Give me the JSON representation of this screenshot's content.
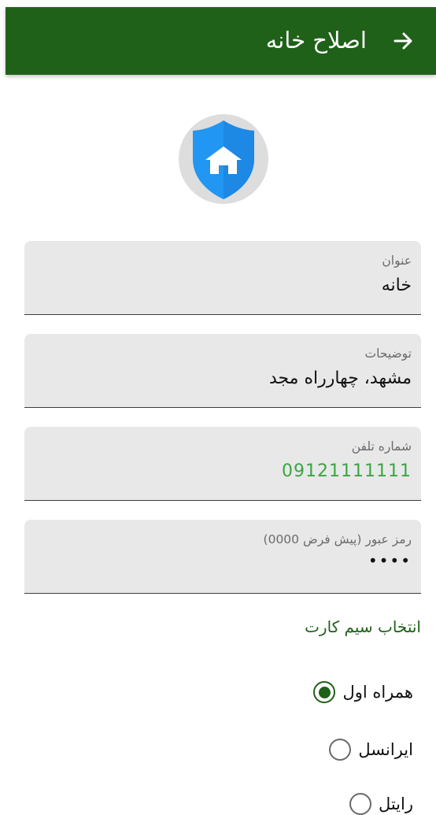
{
  "header": {
    "title": "اصلاح خانه",
    "back_icon": "arrow-forward-icon"
  },
  "logo": {
    "icon": "home-shield-icon",
    "colors": {
      "circle": "#dddddd",
      "shield": "#2196f3",
      "house": "#ffffff"
    }
  },
  "form": {
    "title_field": {
      "label": "عنوان",
      "value": "خانه"
    },
    "description_field": {
      "label": "توضیحات",
      "value": "مشهد، چهارراه مجد"
    },
    "phone_field": {
      "label": "شماره تلفن",
      "value": "09121111111"
    },
    "password_field": {
      "label": "رمز عبور (پیش فرض 0000)",
      "value": "••••"
    }
  },
  "sim": {
    "title": "انتخاب سیم کارت",
    "options": [
      {
        "label": "همراه اول",
        "checked": true
      },
      {
        "label": "ایرانسل",
        "checked": false
      },
      {
        "label": "رایتل",
        "checked": false
      }
    ]
  },
  "colors": {
    "primary": "#1f6118",
    "phone_text": "#3aa641",
    "field_bg": "#e8e8e8"
  }
}
